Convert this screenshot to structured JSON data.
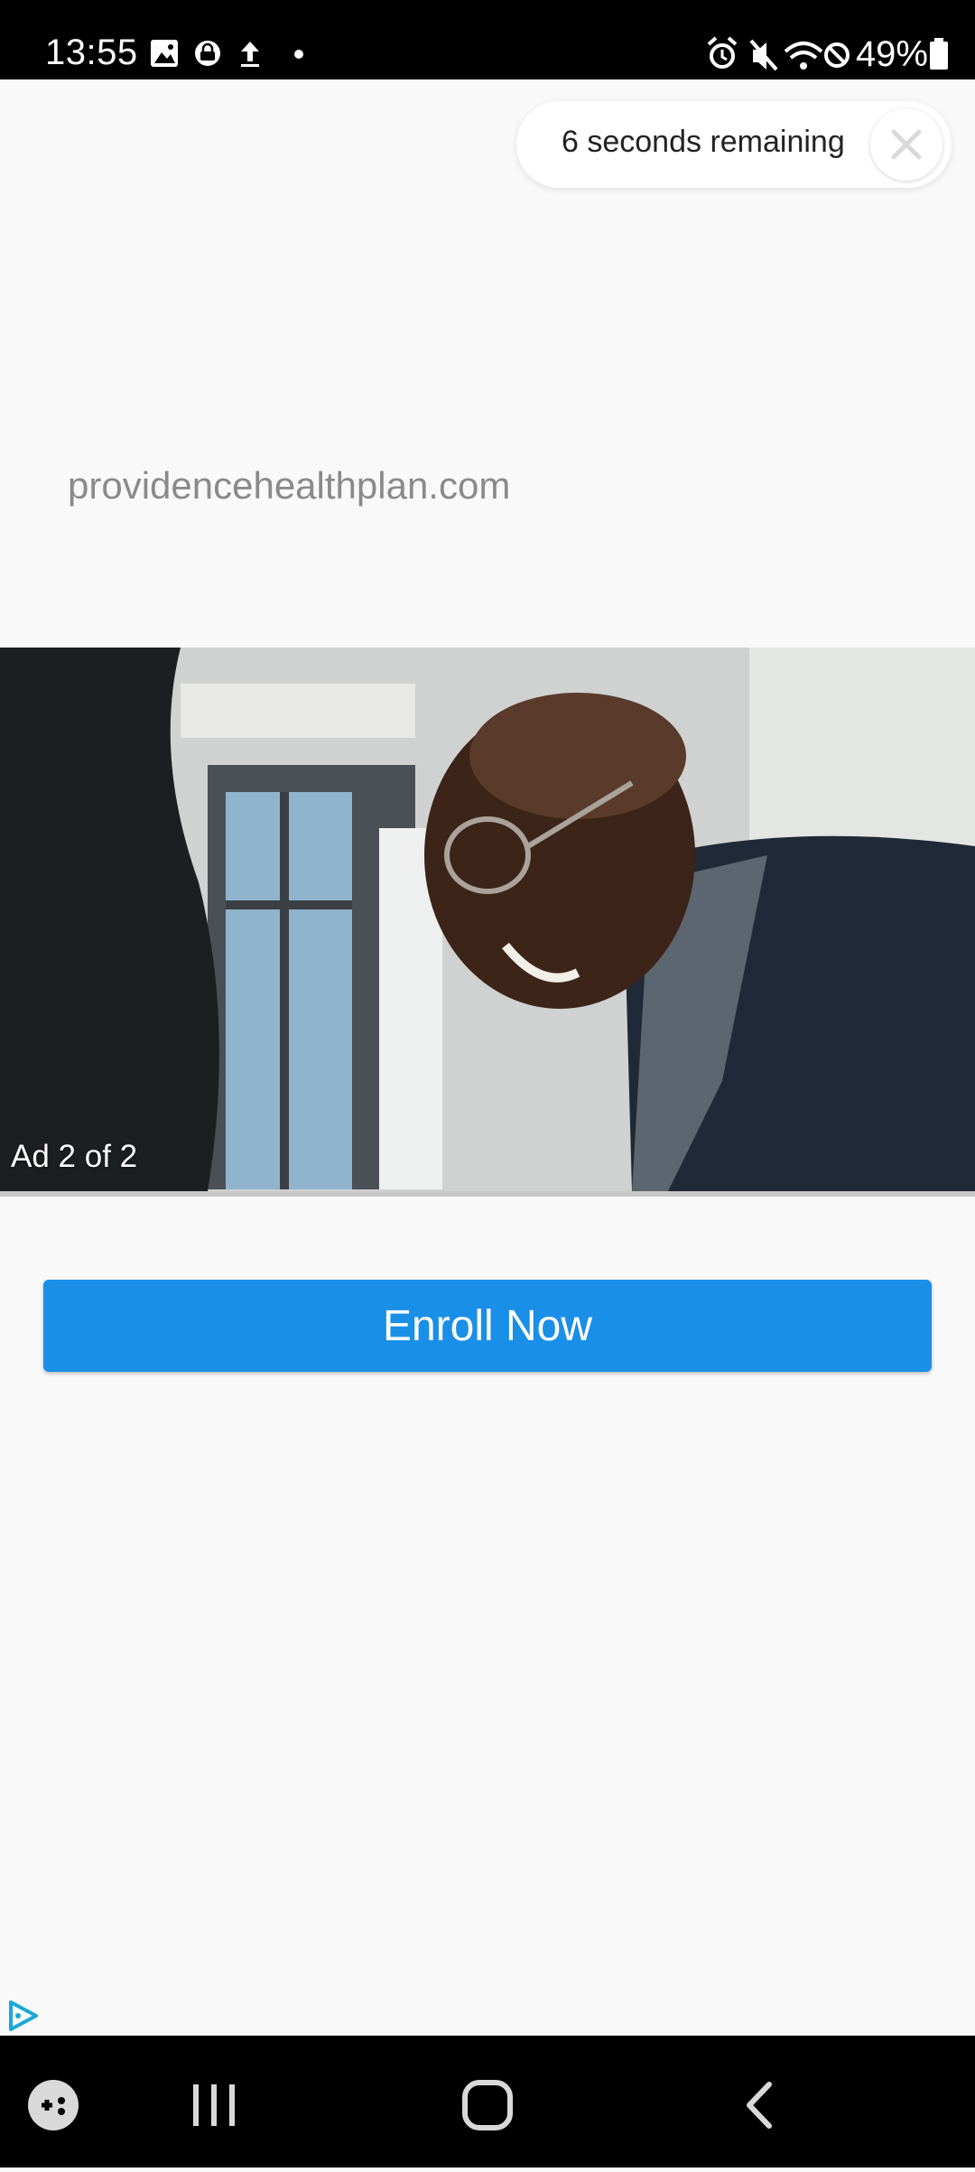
{
  "status_bar": {
    "time": "13:55",
    "battery": "49%",
    "left_icons": [
      "gallery-icon",
      "secure-folder-icon",
      "upload-icon",
      "dot-icon"
    ],
    "right_icons": [
      "alarm-icon",
      "mute-icon",
      "wifi-icon",
      "do-not-disturb-icon",
      "battery-icon"
    ]
  },
  "ad": {
    "skip_countdown": "6 seconds remaining",
    "advertiser_url": "providencehealthplan.com",
    "counter": "Ad 2 of 2",
    "cta_label": "Enroll Now",
    "cta_color": "#1a8fe8"
  },
  "nav_bar": {
    "icons": [
      "game-launcher-icon",
      "recents-icon",
      "home-icon",
      "back-icon"
    ]
  }
}
